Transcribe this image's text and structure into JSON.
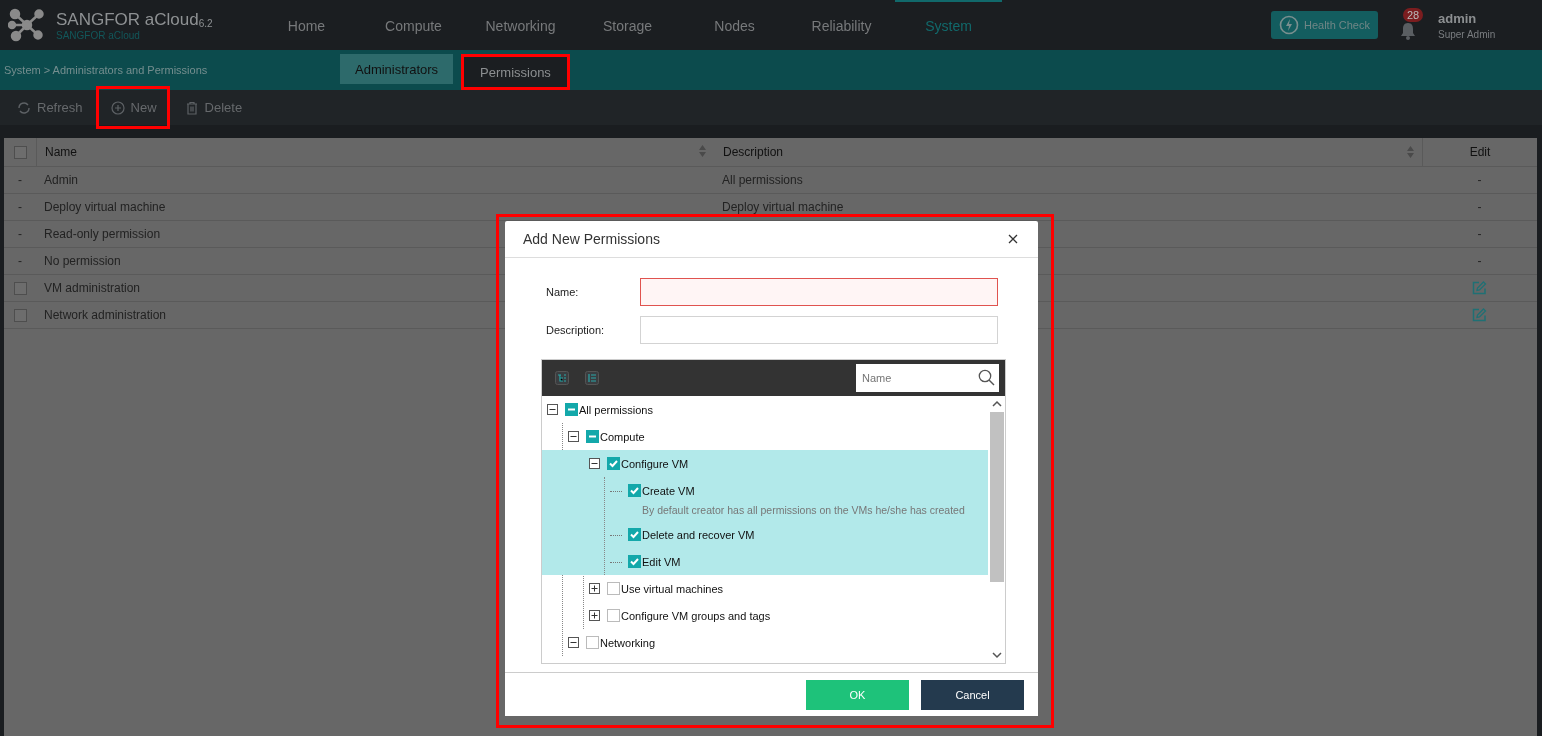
{
  "header": {
    "brand": "SANGFOR aCloud",
    "version": "6.2",
    "subtitle": "SANGFOR aCloud",
    "nav": [
      {
        "label": "Home",
        "selected": false
      },
      {
        "label": "Compute",
        "selected": false
      },
      {
        "label": "Networking",
        "selected": false
      },
      {
        "label": "Storage",
        "selected": false
      },
      {
        "label": "Nodes",
        "selected": false
      },
      {
        "label": "Reliability",
        "selected": false
      },
      {
        "label": "System",
        "selected": true
      }
    ],
    "health_check": "Health Check",
    "notification_count": "28",
    "user": {
      "name": "admin",
      "role": "Super Admin"
    }
  },
  "breadcrumb": "System > Administrators and Permissions",
  "tabs": [
    {
      "label": "Administrators",
      "selected": false,
      "highlighted": false
    },
    {
      "label": "Permissions",
      "selected": true,
      "highlighted": true
    }
  ],
  "toolbar": [
    {
      "label": "Refresh",
      "kind": "refresh",
      "highlighted": false
    },
    {
      "label": "New",
      "kind": "add",
      "highlighted": true
    },
    {
      "label": "Delete",
      "kind": "trash",
      "highlighted": false
    }
  ],
  "table": {
    "select_all_checked": false,
    "columns": [
      "Name",
      "Description",
      "Edit"
    ],
    "rows": [
      {
        "kind": "fixed",
        "select_text": "-",
        "name": "Admin",
        "description": "All permissions",
        "edit_text": "-"
      },
      {
        "kind": "fixed",
        "select_text": "-",
        "name": "Deploy virtual machine",
        "description": "Deploy virtual machine",
        "edit_text": "-"
      },
      {
        "kind": "fixed",
        "select_text": "-",
        "name": "Read-only permission",
        "edit_text": "-"
      },
      {
        "kind": "fixed",
        "select_text": "-",
        "name": "No permission",
        "edit_text": "-"
      },
      {
        "kind": "custom",
        "checked": false,
        "name": "VM administration"
      },
      {
        "kind": "custom",
        "checked": false,
        "name": "Network administration"
      }
    ]
  },
  "dialog": {
    "title": "Add New Permissions",
    "highlighted": true,
    "fields": [
      {
        "label": "Name:",
        "invalid": true
      },
      {
        "label": "Description:",
        "invalid": false
      }
    ],
    "tree": {
      "search_placeholder": "Name",
      "items": [
        {
          "label": "All permissions",
          "partial": true,
          "expanded": true,
          "selected": false,
          "children": [
            {
              "label": "Compute",
              "partial": true,
              "expanded": true,
              "selected": false,
              "children": [
                {
                  "label": "Configure VM",
                  "checked": true,
                  "expanded": true,
                  "selected": true,
                  "children": [
                    {
                      "label": "Create VM",
                      "checked": true,
                      "selected": false,
                      "note": "By default creator has all permissions on the VMs he/she has created"
                    },
                    {
                      "label": "Delete and recover VM",
                      "checked": true,
                      "selected": false
                    },
                    {
                      "label": "Edit VM",
                      "checked": true,
                      "selected": false
                    }
                  ]
                },
                {
                  "label": "Use virtual machines",
                  "checked": false,
                  "expanded": false,
                  "selected": false
                },
                {
                  "label": "Configure VM groups and tags",
                  "checked": false,
                  "expanded": false,
                  "selected": false
                }
              ]
            },
            {
              "label": "Networking",
              "checked": false,
              "expanded": true,
              "selected": false
            }
          ]
        }
      ]
    },
    "buttons": [
      {
        "label": "OK",
        "kind": "primary"
      },
      {
        "label": "Cancel",
        "kind": "secondary"
      }
    ]
  }
}
